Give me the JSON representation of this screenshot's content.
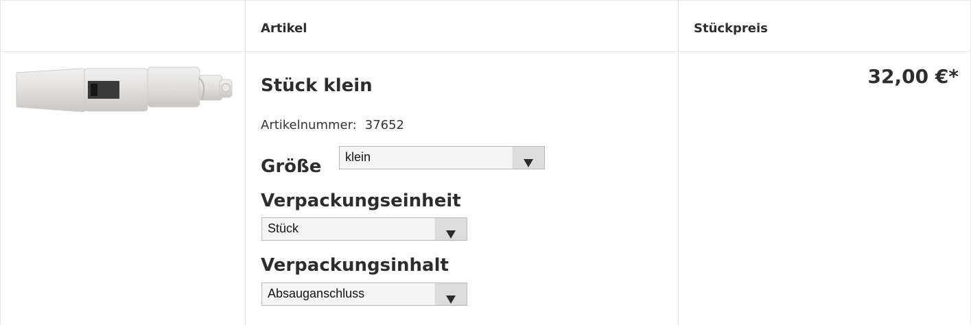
{
  "table": {
    "headers": {
      "image": "",
      "article": "Artikel",
      "unit_price": "Stückpreis"
    }
  },
  "product": {
    "image_desc": "product-photo",
    "name": "Stück klein",
    "article_number_label": "Artikelnummer:",
    "article_number": "37652",
    "options": {
      "size_label": "Größe",
      "size_value": "klein",
      "packaging_unit_label": "Verpackungseinheit",
      "packaging_unit_value": "Stück",
      "packaging_content_label": "Verpackungsinhalt",
      "packaging_content_value": "Absauganschluss"
    },
    "price": "32,00 €*"
  },
  "colors": {
    "border": "#e6e6e6",
    "text": "#2d2d2d",
    "select_bg": "#f5f5f5",
    "select_btn": "#dcdcdc"
  }
}
